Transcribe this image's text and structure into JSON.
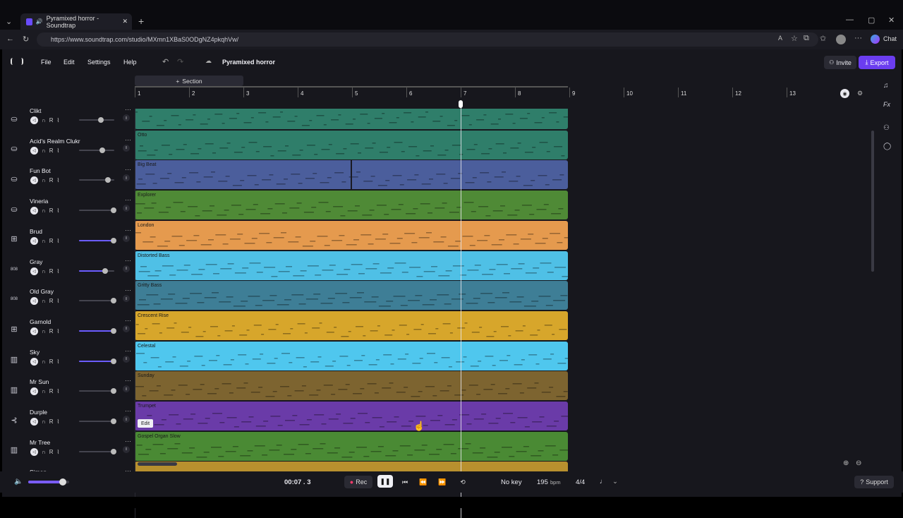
{
  "browser": {
    "tab_title": "Pyramixed horror - Soundtrap",
    "url": "https://www.soundtrap.com/studio/MXmn1XBaS0ODgNZ4pkqhVw/",
    "chat_label": "Chat"
  },
  "app": {
    "menu": [
      "File",
      "Edit",
      "Settings",
      "Help"
    ],
    "project_title": "Pyramixed horror",
    "invite_label": "Invite",
    "export_label": "Export",
    "section_label": "Section",
    "ruler": [
      "1",
      "2",
      "3",
      "4",
      "5",
      "6",
      "7",
      "8",
      "9",
      "10",
      "11",
      "12",
      "13"
    ],
    "playhead_bar": 7
  },
  "tracks": [
    {
      "name": "Clikt",
      "icon": "drum",
      "region": "",
      "color": "#2f7e6a",
      "vol": 0.62,
      "purple": false
    },
    {
      "name": "Acid's Realm Clukr",
      "icon": "drum",
      "region": "Otto",
      "color": "#2f7e6a",
      "vol": 0.66,
      "purple": false
    },
    {
      "name": "Fun Bot",
      "icon": "drum",
      "region": "Big Beat",
      "color": "#4b5e9c",
      "vol": 0.82,
      "purple": false
    },
    {
      "name": "Vineria",
      "icon": "drum",
      "region": "Explorer",
      "color": "#4f8a36",
      "vol": 0.98,
      "purple": false
    },
    {
      "name": "Brud",
      "icon": "keys",
      "region": "London",
      "color": "#e59a4e",
      "vol": 0.98,
      "purple": true
    },
    {
      "name": "Gray",
      "icon": "808",
      "region": "Distorted Bass",
      "color": "#4fc0e6",
      "vol": 0.74,
      "purple": true
    },
    {
      "name": "Old Gray",
      "icon": "808",
      "region": "Gritty Bass",
      "color": "#3e7e96",
      "vol": 0.98,
      "purple": false
    },
    {
      "name": "Garnold",
      "icon": "keys",
      "region": "Crescent Rise",
      "color": "#d7a62b",
      "vol": 0.98,
      "purple": true
    },
    {
      "name": "Sky",
      "icon": "piano",
      "region": "Celestal",
      "color": "#4fc7ee",
      "vol": 0.98,
      "purple": true
    },
    {
      "name": "Mr Sun",
      "icon": "piano",
      "region": "Sunday",
      "color": "#7d6430",
      "vol": 0.98,
      "purple": false
    },
    {
      "name": "Durple",
      "icon": "horn",
      "region": "Trumpet",
      "color": "#6a3ba8",
      "vol": 0.98,
      "purple": false
    },
    {
      "name": "Mr Tree",
      "icon": "piano",
      "region": "Gospel Organ Slow",
      "color": "#4a8a34",
      "vol": 0.98,
      "purple": false
    },
    {
      "name": "Simon",
      "icon": "piano",
      "region": "",
      "color": "#b8902e",
      "vol": 0.98,
      "purple": false
    }
  ],
  "track_ctrl": {
    "record": "R"
  },
  "edit_button": "Edit",
  "transport": {
    "time": "00:07 . 3",
    "rec_label": "Rec",
    "key": "No key",
    "bpm_value": "195",
    "bpm_unit": "bpm",
    "signature": "4/4",
    "support_label": "Support",
    "master_volume": 0.85
  },
  "sidebar_right": [
    "music-note-icon",
    "fx-icon",
    "collab-icon",
    "chat-icon"
  ],
  "fx_label": "Fx"
}
